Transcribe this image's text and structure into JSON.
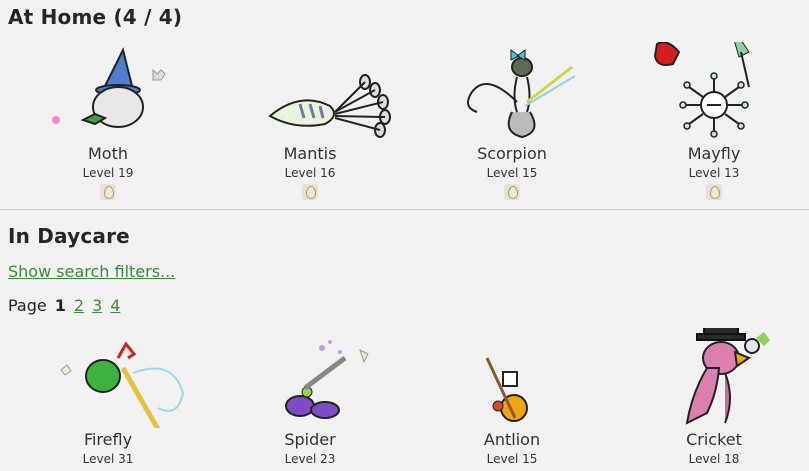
{
  "home": {
    "title": "At Home (4 / 4)",
    "pets": [
      {
        "name": "Moth",
        "level": "Level 19"
      },
      {
        "name": "Mantis",
        "level": "Level 16"
      },
      {
        "name": "Scorpion",
        "level": "Level 15"
      },
      {
        "name": "Mayfly",
        "level": "Level 13"
      }
    ]
  },
  "daycare": {
    "title": "In Daycare",
    "filters_link": "Show search filters...",
    "pager": {
      "label": "Page",
      "current": "1",
      "pages": [
        "2",
        "3",
        "4"
      ]
    },
    "pets": [
      {
        "name": "Firefly",
        "level": "Level 31"
      },
      {
        "name": "Spider",
        "level": "Level 23"
      },
      {
        "name": "Antlion",
        "level": "Level 15"
      },
      {
        "name": "Cricket",
        "level": "Level 18"
      }
    ]
  }
}
